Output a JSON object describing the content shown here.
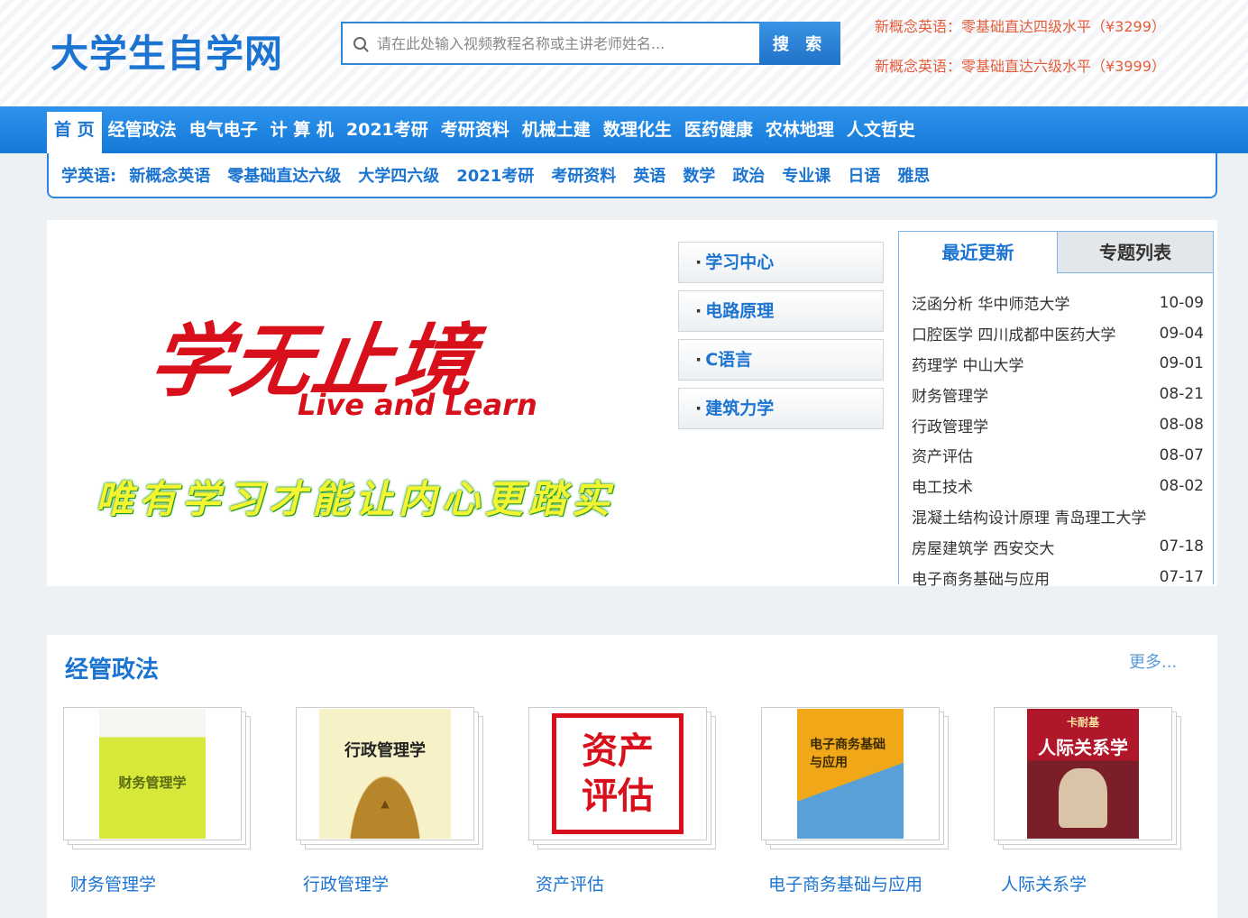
{
  "header": {
    "logo": "大学生自学网",
    "search_placeholder": "请在此处输入视频教程名称或主讲老师姓名...",
    "search_button": "搜 索",
    "promos": [
      "新概念英语：零基础直达四级水平（¥3299）",
      "新概念英语：零基础直达六级水平（¥3999）"
    ]
  },
  "nav": {
    "items": [
      "首 页",
      "经管政法",
      "电气电子",
      "计 算 机",
      "2021考研",
      "考研资料",
      "机械土建",
      "数理化生",
      "医药健康",
      "农林地理",
      "人文哲史"
    ]
  },
  "subnav": {
    "label": "学英语:",
    "items": [
      "新概念英语",
      "零基础直达六级",
      "大学四六级",
      "2021考研",
      "考研资料",
      "英语",
      "数学",
      "政治",
      "专业课",
      "日语",
      "雅思"
    ]
  },
  "banner": {
    "slogan_cn": "学无止境",
    "slogan_en": "Live and Learn",
    "slogan_sub": "唯有学习才能让内心更踏实"
  },
  "quick_links": [
    "学习中心",
    "电路原理",
    "C语言",
    "建筑力学"
  ],
  "updates": {
    "tabs": [
      "最近更新",
      "专题列表"
    ],
    "items": [
      {
        "title": "泛函分析 华中师范大学",
        "date": "10-09"
      },
      {
        "title": "口腔医学 四川成都中医药大学",
        "date": "09-04"
      },
      {
        "title": "药理学 中山大学",
        "date": "09-01"
      },
      {
        "title": "财务管理学",
        "date": "08-21"
      },
      {
        "title": "行政管理学",
        "date": "08-08"
      },
      {
        "title": "资产评估",
        "date": "08-07"
      },
      {
        "title": "电工技术",
        "date": "08-02"
      },
      {
        "title": "混凝土结构设计原理 青岛理工大学",
        "date": ""
      },
      {
        "title": "房屋建筑学 西安交大",
        "date": "07-18"
      },
      {
        "title": "电子商务基础与应用",
        "date": "07-17"
      }
    ]
  },
  "section": {
    "title": "经管政法",
    "more": "更多...",
    "books": [
      {
        "label": "财务管理学",
        "cover_text": "财务管理学"
      },
      {
        "label": "行政管理学",
        "cover_text": "行政管理学"
      },
      {
        "label": "资产评估",
        "cover_text": "资产评估"
      },
      {
        "label": "电子商务基础与应用",
        "cover_text": "电子商务基础与应用"
      },
      {
        "label": "人际关系学",
        "cover_text": "人际关系学",
        "cover_subtext": "卡耐基"
      }
    ]
  },
  "colors": {
    "brand": "#1b74d1",
    "nav_bg": "#1f85e0",
    "promo": "#e65c3b",
    "slogan_red": "#d8101b",
    "slogan_yellow": "#f4f431"
  }
}
